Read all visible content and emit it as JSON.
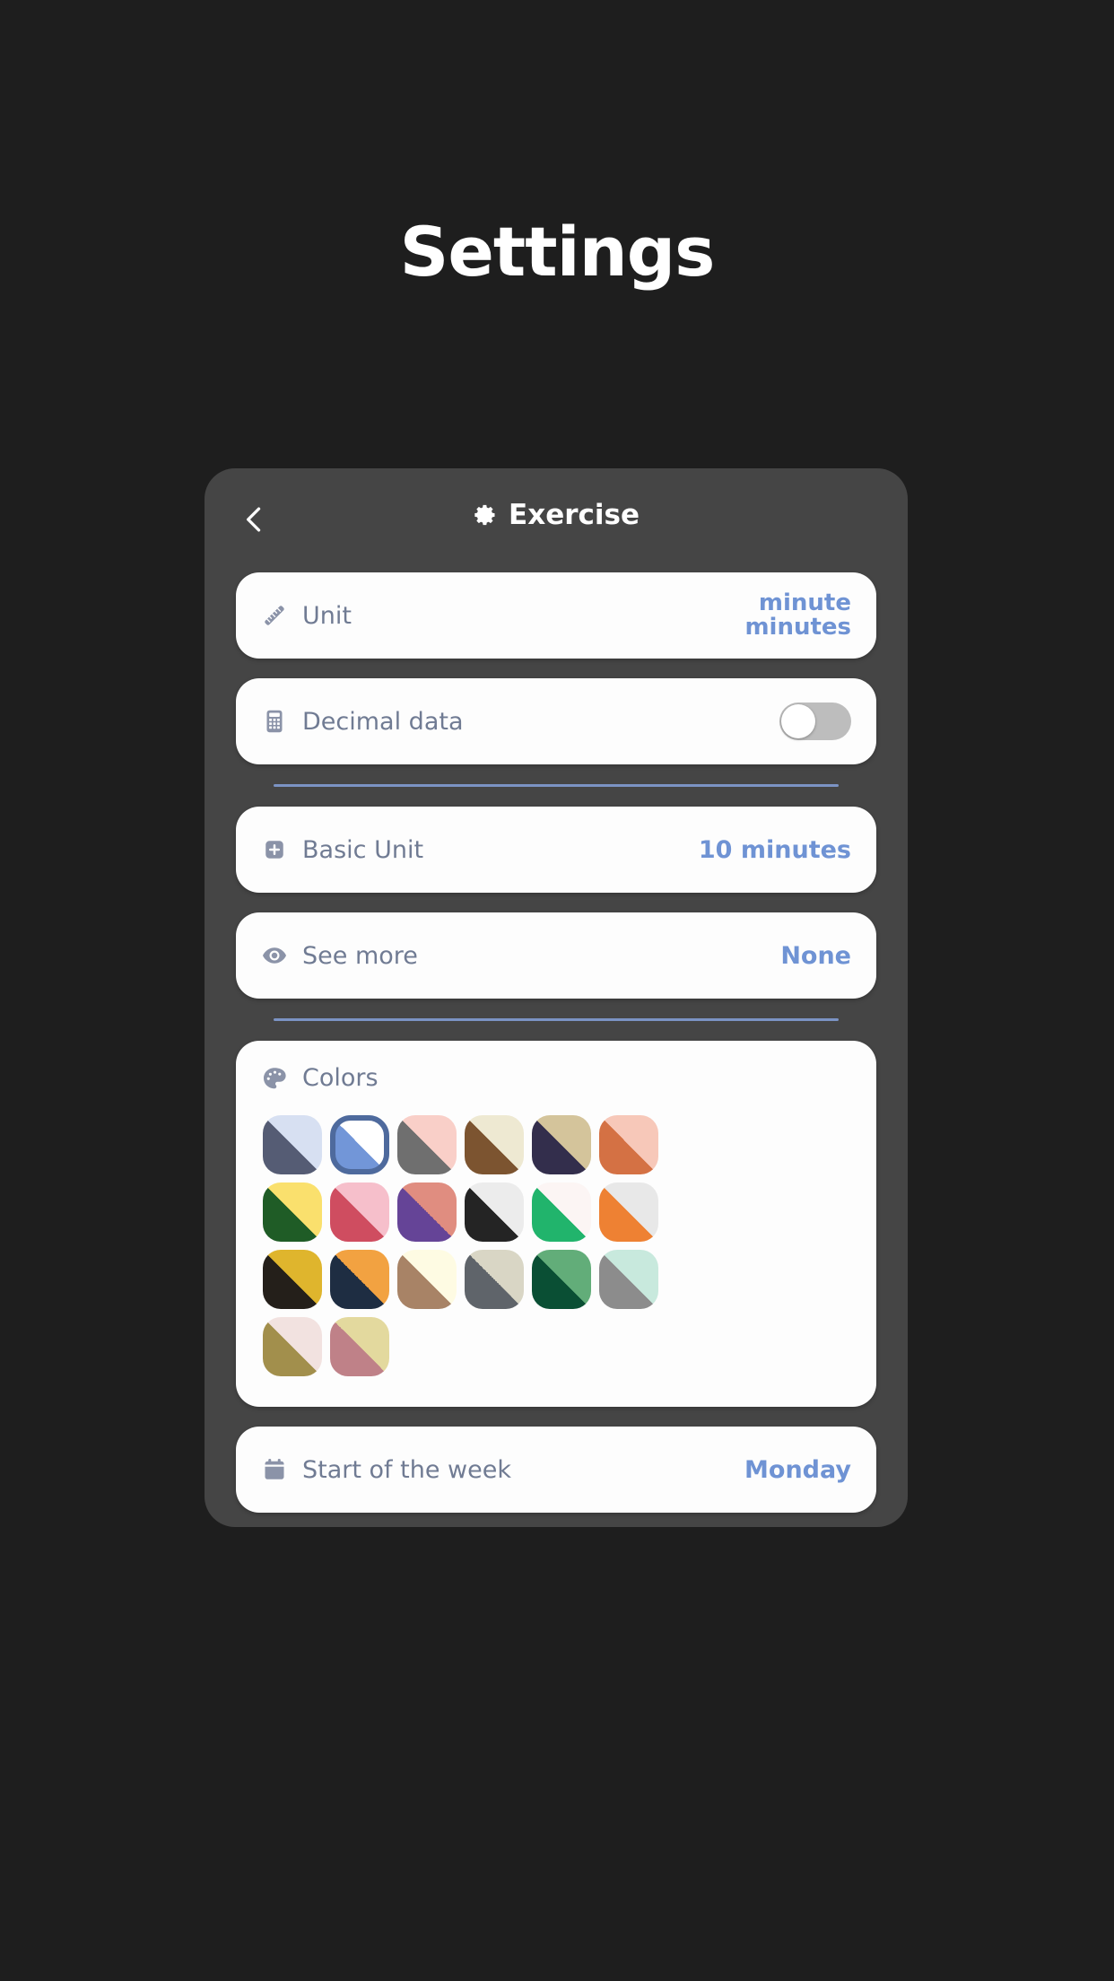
{
  "page": {
    "title": "Settings",
    "background": "#1e1e1e",
    "card_background": "#454545"
  },
  "header": {
    "back_icon": "chevron-left-icon",
    "gear_icon": "gear-icon",
    "title": "Exercise"
  },
  "colors": {
    "label_color": "#707b93",
    "value_color": "#6f93d4",
    "divider_color": "#7b93c4"
  },
  "rows": [
    {
      "key": "unit",
      "icon": "ruler-icon",
      "label": "Unit",
      "value_line1": "minute",
      "value_line2": "minutes",
      "type": "stacked-value"
    },
    {
      "key": "decimal_data",
      "icon": "calculator-icon",
      "label": "Decimal data",
      "type": "toggle",
      "toggle_on": false
    },
    {
      "key": "basic_unit",
      "icon": "plus-square-icon",
      "label": "Basic Unit",
      "value": "10 minutes",
      "type": "value"
    },
    {
      "key": "see_more",
      "icon": "eye-icon",
      "label": "See more",
      "value": "None",
      "type": "value"
    },
    {
      "key": "start_of_week",
      "icon": "calendar-icon",
      "label": "Start of the week",
      "value": "Monday",
      "type": "value"
    }
  ],
  "colors_section": {
    "icon": "palette-icon",
    "label": "Colors",
    "selected_index": 1,
    "selection_ring_color": "#4e6a9d",
    "swatches": [
      {
        "dark": "#555c74",
        "light": "#d7e0f2"
      },
      {
        "dark": "#7296d8",
        "light": "#ffffff"
      },
      {
        "dark": "#6f6f6f",
        "light": "#f9cfc8"
      },
      {
        "dark": "#7c5430",
        "light": "#eee9d2"
      },
      {
        "dark": "#332e4c",
        "light": "#d4c49b"
      },
      {
        "dark": "#d47144",
        "light": "#f7c8b9"
      },
      {
        "dark": "#1f5c26",
        "light": "#fae06d"
      },
      {
        "dark": "#cf4d60",
        "light": "#f6bfcb"
      },
      {
        "dark": "#654497",
        "light": "#e08d80"
      },
      {
        "dark": "#242424",
        "light": "#ececec"
      },
      {
        "dark": "#21b46c",
        "light": "#fcf5f4"
      },
      {
        "dark": "#ee8133",
        "light": "#e8e8e8"
      },
      {
        "dark": "#241f1a",
        "light": "#dfb52d"
      },
      {
        "dark": "#1e2d42",
        "light": "#f2a241"
      },
      {
        "dark": "#a88366",
        "light": "#fefbe3"
      },
      {
        "dark": "#5f646a",
        "light": "#d9d6c5"
      },
      {
        "dark": "#0a4f34",
        "light": "#62ad79"
      },
      {
        "dark": "#8c8c8c",
        "light": "#c8e9dd"
      },
      {
        "dark": "#a28f4c",
        "light": "#f2e2e0"
      },
      {
        "dark": "#bf8188",
        "light": "#e3d99e"
      }
    ]
  }
}
